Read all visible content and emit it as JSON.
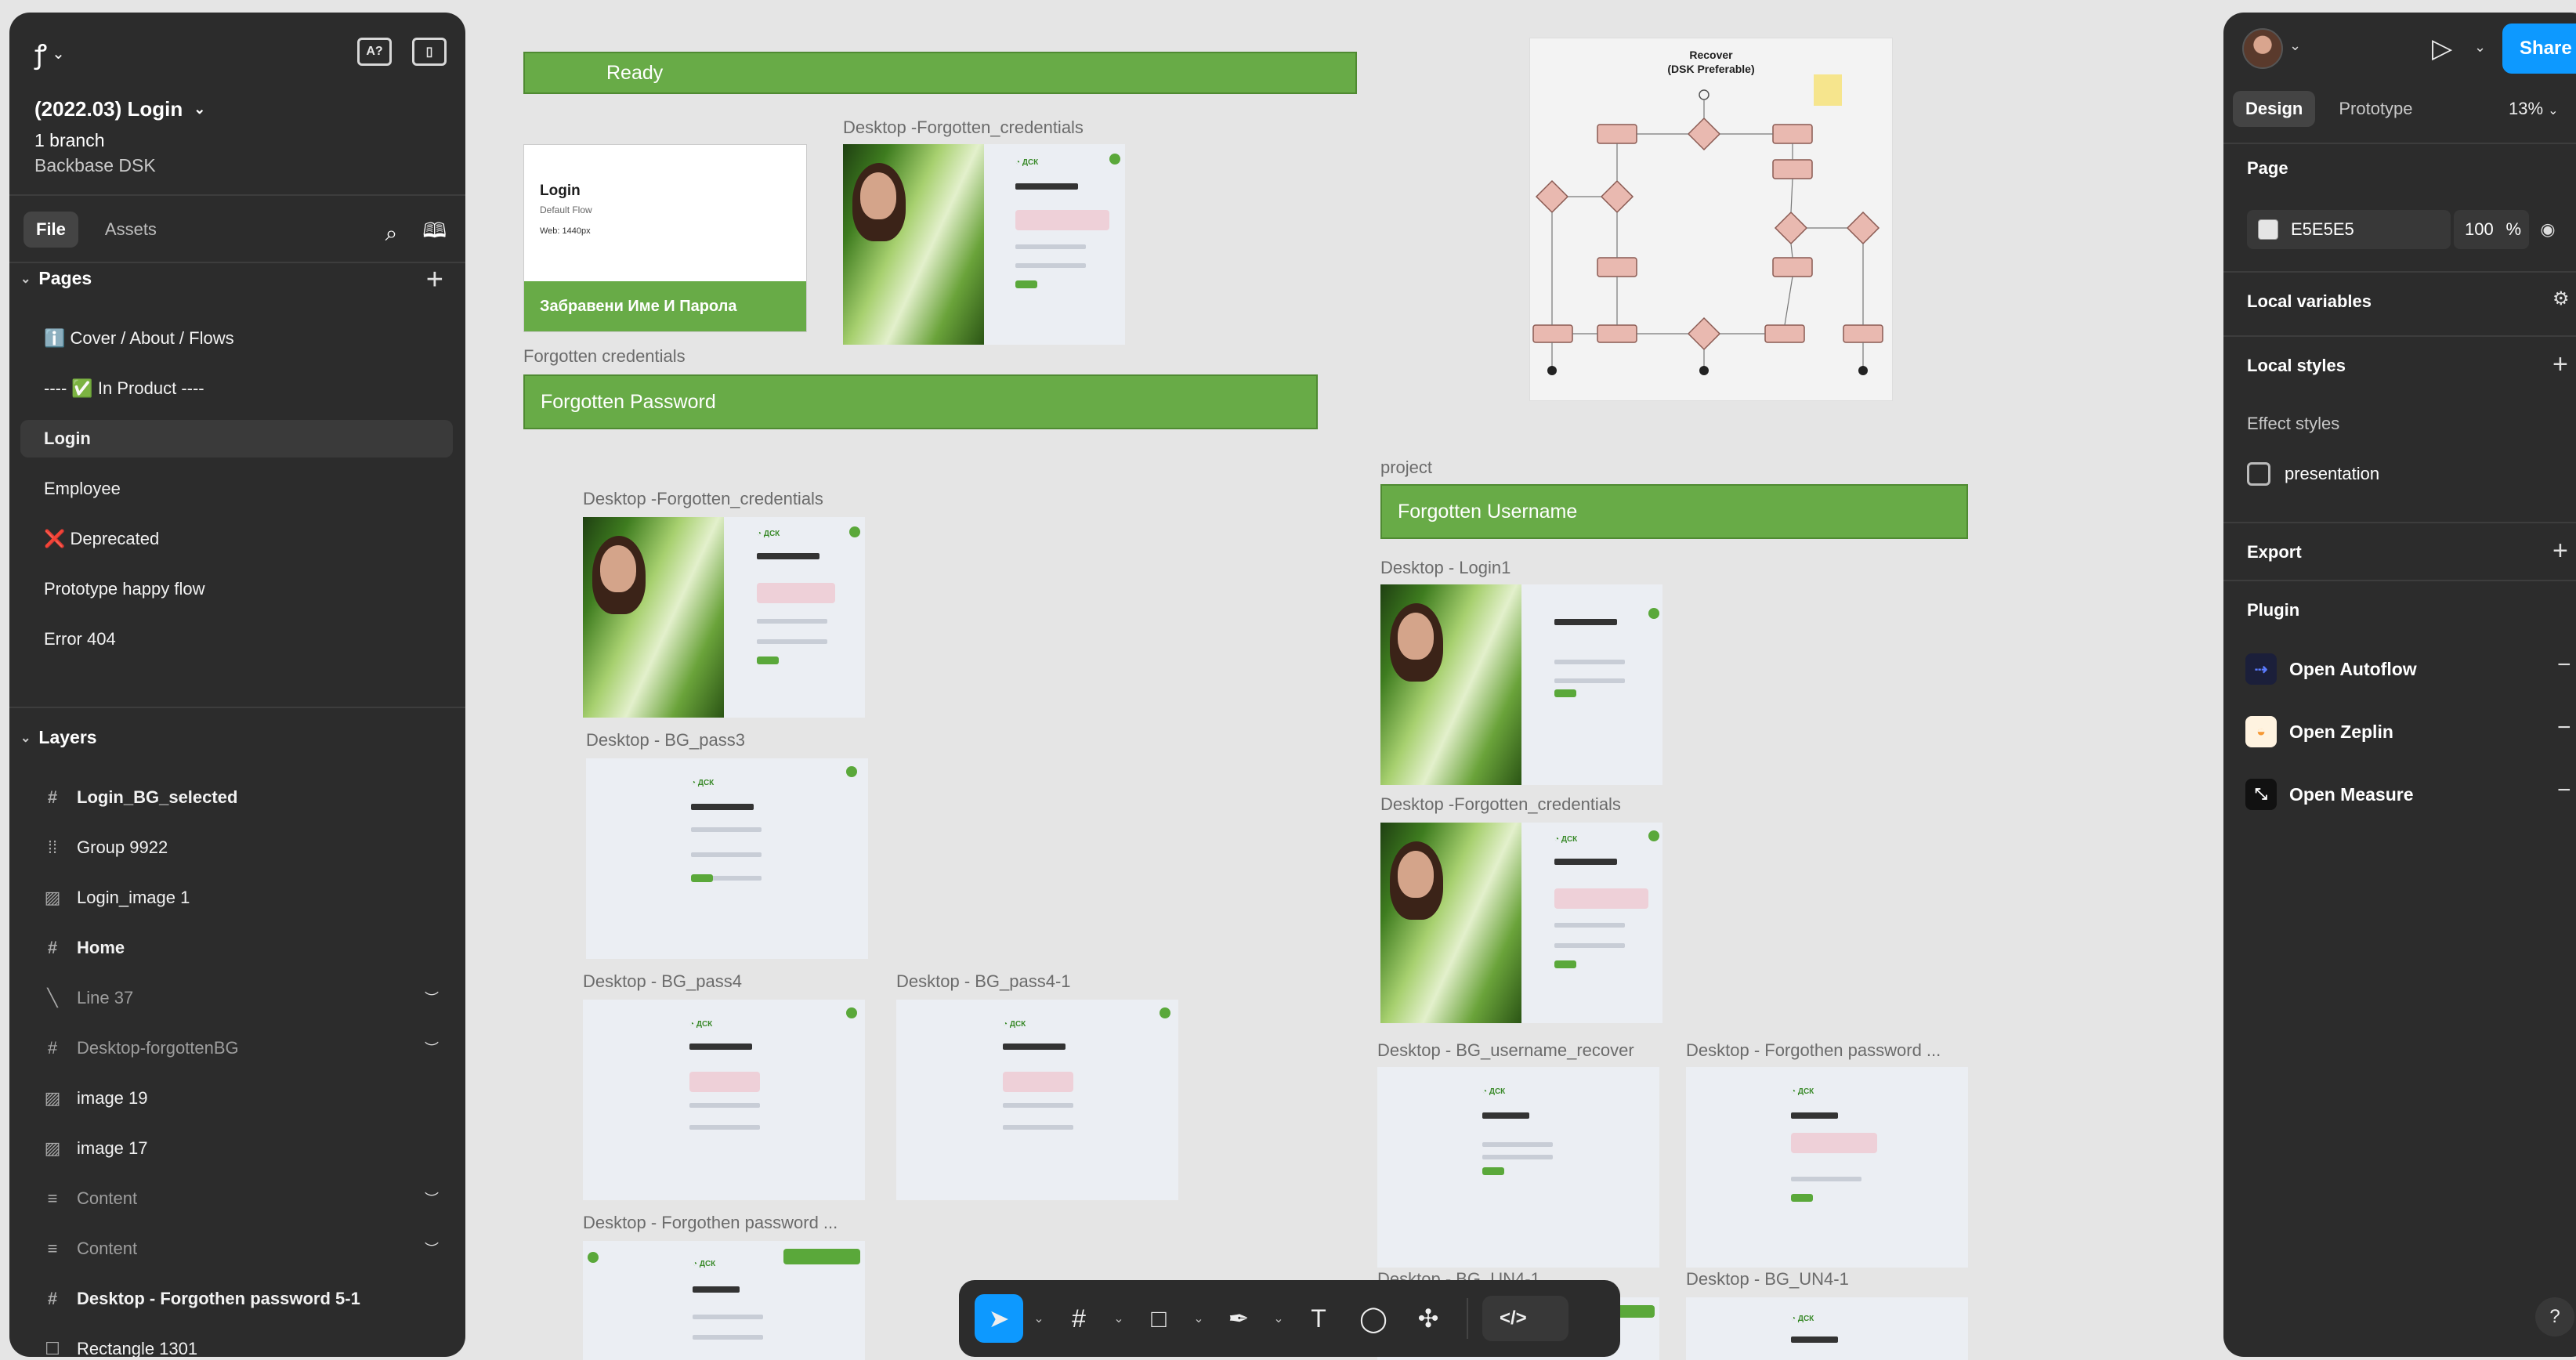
{
  "file": {
    "title": "(2022.03) Login",
    "branch": "1 branch",
    "team": "Backbase DSK"
  },
  "left_tabs": {
    "file": "File",
    "assets": "Assets"
  },
  "pages": {
    "heading": "Pages",
    "items": [
      {
        "label": "ℹ️ Cover / About / Flows"
      },
      {
        "label": "---- ✅ In Product ----"
      },
      {
        "label": "Login"
      },
      {
        "label": "Employee"
      },
      {
        "label": "❌ Deprecated"
      },
      {
        "label": "Prototype happy flow"
      },
      {
        "label": "Error 404"
      }
    ]
  },
  "layers": {
    "heading": "Layers",
    "items": [
      {
        "label": "Login_BG_selected",
        "icon": "frame-icon"
      },
      {
        "label": "Group 9922",
        "icon": "group-icon"
      },
      {
        "label": "Login_image 1",
        "icon": "image-icon"
      },
      {
        "label": "Home",
        "icon": "frame-icon"
      },
      {
        "label": "Line 37",
        "icon": "line-icon"
      },
      {
        "label": "Desktop-forgottenBG",
        "icon": "frame-icon"
      },
      {
        "label": "image 19",
        "icon": "image-icon"
      },
      {
        "label": "image 17",
        "icon": "image-icon"
      },
      {
        "label": "Content",
        "icon": "autolayout-icon"
      },
      {
        "label": "Content",
        "icon": "autolayout-icon"
      },
      {
        "label": "Desktop - Forgothen password 5-1",
        "icon": "frame-icon"
      },
      {
        "label": "Rectangle 1301",
        "icon": "rectangle-icon"
      }
    ]
  },
  "right_panel": {
    "share": "Share",
    "tabs": {
      "design": "Design",
      "prototype": "Prototype"
    },
    "zoom": "13%",
    "page_heading": "Page",
    "page_color": "E5E5E5",
    "page_opacity": "100",
    "percent": "%",
    "local_variables": "Local variables",
    "local_styles": "Local styles",
    "effect_styles": "Effect styles",
    "presentation": "presentation",
    "export": "Export",
    "plugin": "Plugin",
    "plugins": [
      {
        "label": "Open Autoflow"
      },
      {
        "label": "Open Zeplin"
      },
      {
        "label": "Open Measure"
      }
    ],
    "help": "?"
  },
  "canvas": {
    "banner_ready": "Ready",
    "banner_forgotten_password": "Forgotten Password",
    "banner_forgotten_username": "Forgotten  Username",
    "label_forgotten_credentials_section": "Forgotten credentials",
    "label_project": "project",
    "login_card": {
      "title": "Login",
      "subtitle": "Default Flow",
      "web": "Web: 1440px",
      "footer": "Забравени Име И Парола"
    },
    "flow_card": {
      "title_line1": "Recover",
      "title_line2": "(DSK Preferable)"
    },
    "frames": [
      {
        "label": "Desktop -Forgotten_credentials"
      },
      {
        "label": "Desktop -Forgotten_credentials"
      },
      {
        "label": "Desktop - BG_pass3"
      },
      {
        "label": "Desktop - BG_pass4"
      },
      {
        "label": "Desktop - BG_pass4-1"
      },
      {
        "label": "Desktop - Forgothen password ..."
      },
      {
        "label": "Desktop - Login1"
      },
      {
        "label": "Desktop -Forgotten_credentials"
      },
      {
        "label": "Desktop - BG_username_recover"
      },
      {
        "label": "Desktop - Forgothen password ..."
      },
      {
        "label": "Desktop - BG_UN4-1"
      },
      {
        "label": "Desktop - BG_UN4-1"
      }
    ]
  },
  "colors": {
    "accent": "#0d99ff",
    "brand_green": "#68ab47",
    "canvas": "#E5E5E5"
  }
}
